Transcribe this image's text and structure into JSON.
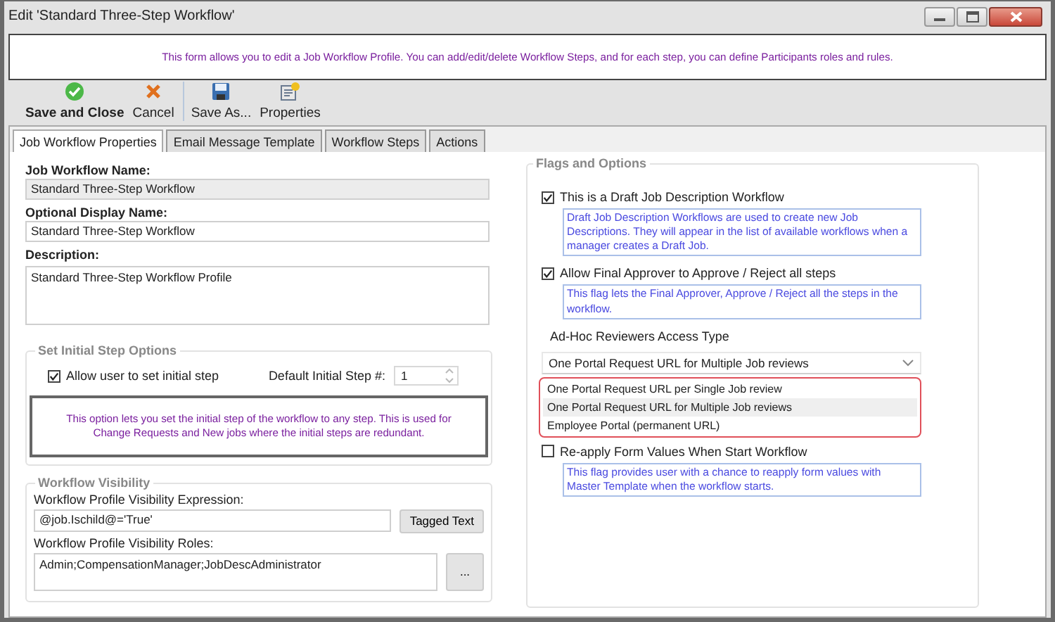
{
  "window": {
    "title": "Edit 'Standard Three-Step Workflow'"
  },
  "banner": "This form allows you to edit a Job Workflow Profile. You can add/edit/delete Workflow Steps, and for each step, you can define Participants roles and rules.",
  "toolbar": [
    {
      "kind": "save",
      "label": "Save and Close",
      "bold": true,
      "separator_before": false
    },
    {
      "kind": "cancel",
      "label": "Cancel",
      "bold": false,
      "separator_before": false
    },
    {
      "kind": "save_as",
      "label": "Save As...",
      "bold": false,
      "separator_before": true
    },
    {
      "kind": "properties",
      "label": "Properties",
      "bold": false,
      "separator_before": false
    }
  ],
  "tabs": [
    {
      "label": "Job Workflow Properties",
      "selected": true
    },
    {
      "label": "Email Message Template",
      "selected": false
    },
    {
      "label": "Workflow Steps",
      "selected": false
    },
    {
      "label": "Actions",
      "selected": false
    }
  ],
  "properties": {
    "name": {
      "label": "Job Workflow Name:",
      "value": "Standard Three-Step Workflow",
      "readonly": true
    },
    "display_name": {
      "label": "Optional Display Name:",
      "value": "Standard Three-Step Workflow",
      "readonly": false
    },
    "description": {
      "label": "Description:",
      "value": "Standard Three-Step Workflow Profile"
    }
  },
  "initial_step": {
    "legend": "Set Initial Step Options",
    "allow": {
      "label": "Allow user to set initial step",
      "checked": true
    },
    "default_step": {
      "label": "Default Initial Step #:",
      "value": "1"
    },
    "note": "This option lets you set the initial step of the workflow to any step.  This is used for Change Requests and New jobs where the initial steps are redundant."
  },
  "visibility": {
    "legend": "Workflow Visibility",
    "expression": {
      "label": "Workflow Profile Visibility Expression:",
      "value": "@job.Ischild@='True'",
      "button": "Tagged Text"
    },
    "roles": {
      "label": "Workflow Profile Visibility Roles:",
      "value": "Admin;CompensationManager;JobDescAdministrator",
      "button": "..."
    }
  },
  "flags": {
    "legend": "Flags and Options",
    "items": [
      {
        "kind": "checkbox",
        "label": "This is a Draft Job Description Workflow",
        "checked": true,
        "note": "Draft Job Description Workflows are used to create new Job Descriptions. They will appear in the list of available workflows when a manager creates a Draft Job."
      },
      {
        "kind": "checkbox",
        "label": "Allow Final Approver to Approve / Reject all steps",
        "checked": true,
        "note": "This flag lets the Final Approver, Approve / Reject all the steps in the workflow."
      },
      {
        "kind": "select",
        "label": "Ad-Hoc Reviewers Access Type",
        "value": "One Portal Request URL for Multiple Job reviews",
        "expanded": true,
        "options": [
          {
            "label": "One Portal Request URL per Single Job review",
            "selected": false
          },
          {
            "label": "One Portal Request URL for Multiple Job reviews",
            "selected": true
          },
          {
            "label": "Employee Portal (permanent URL)",
            "selected": false
          }
        ]
      },
      {
        "kind": "checkbox",
        "label": "Re-apply Form Values When Start Workflow",
        "checked": false,
        "note": "This flag provides user with a chance to reapply form values with Master Template when the workflow starts."
      }
    ]
  }
}
